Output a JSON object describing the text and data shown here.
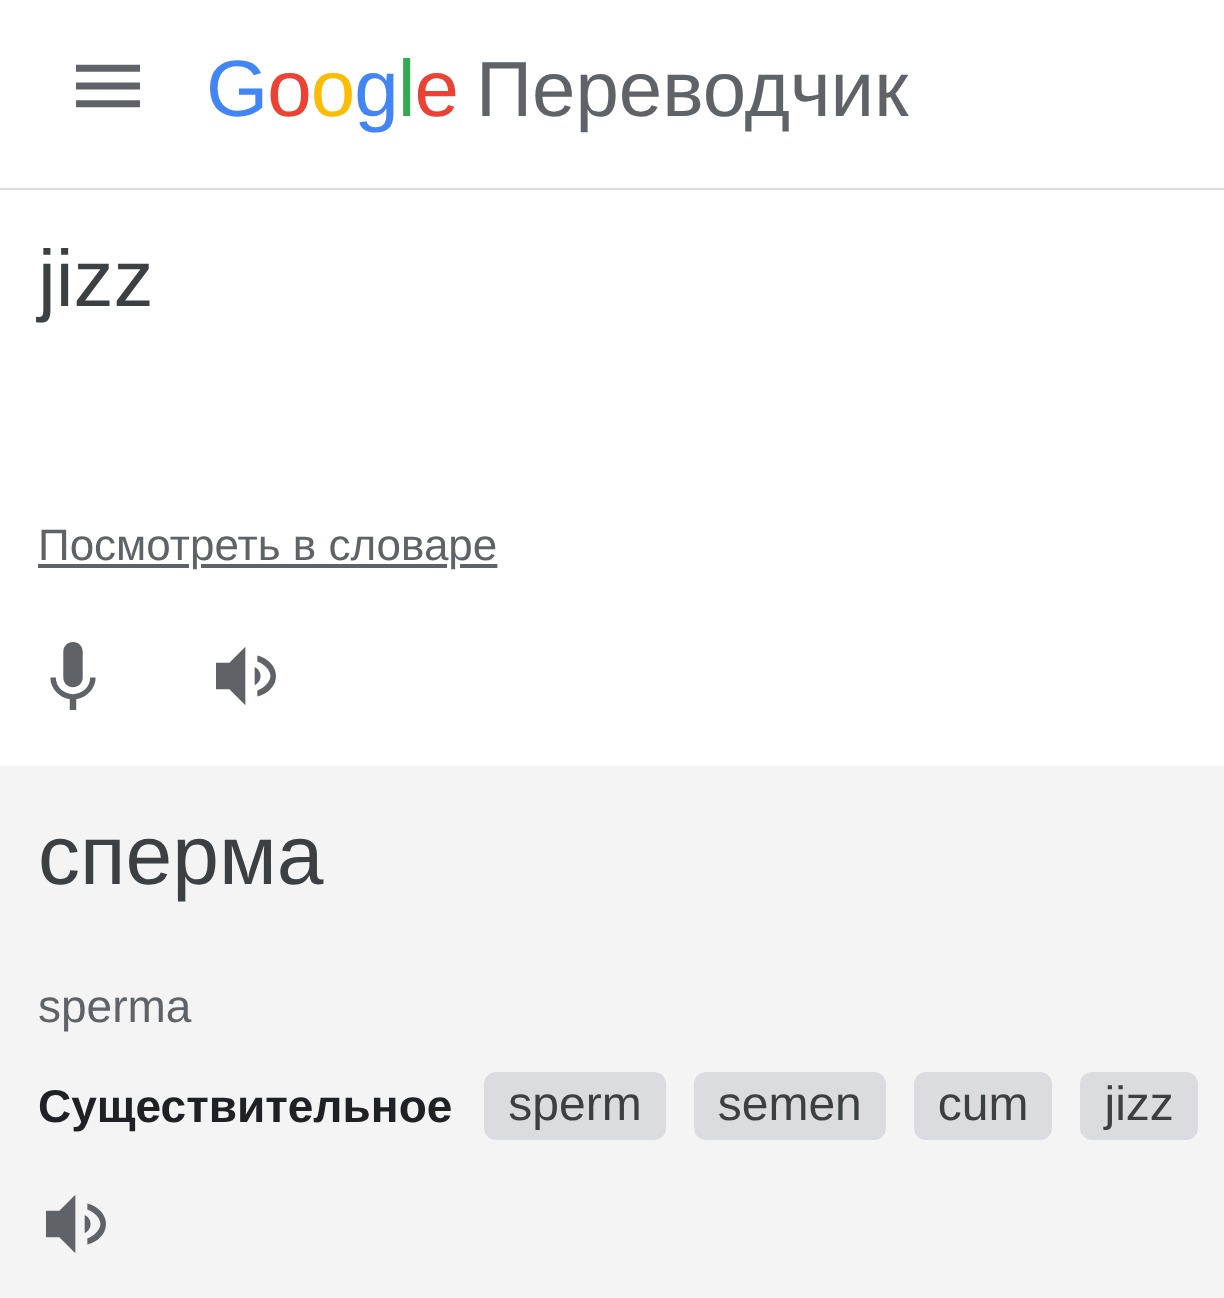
{
  "header": {
    "logo": "Google",
    "title": "Переводчик"
  },
  "source": {
    "text": "jizz",
    "dictionary_link": "Посмотреть в словаре"
  },
  "result": {
    "translation": "сперма",
    "transliteration": "sperma",
    "part_of_speech": "Существительное",
    "synonyms": [
      "sperm",
      "semen",
      "cum",
      "jizz"
    ]
  }
}
